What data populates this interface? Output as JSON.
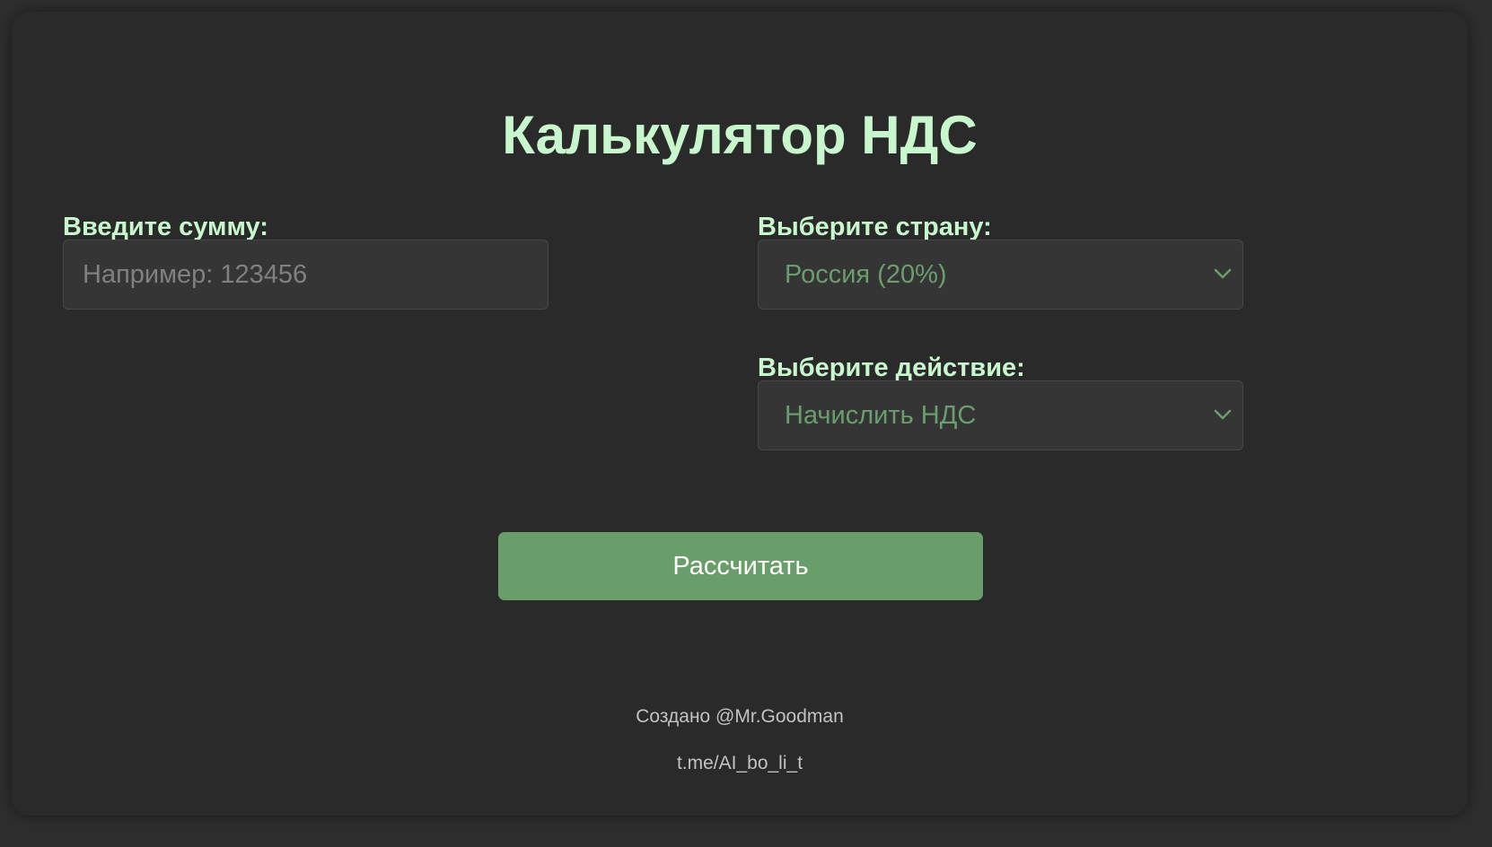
{
  "page": {
    "title": "Калькулятор НДС"
  },
  "amount": {
    "label": "Введите сумму:",
    "placeholder": "Например: 123456",
    "value": ""
  },
  "country": {
    "label": "Выберите страну:",
    "selected": "Россия (20%)"
  },
  "action": {
    "label": "Выберите действие:",
    "selected": "Начислить НДС"
  },
  "calculate_button": {
    "label": "Рассчитать"
  },
  "footer": {
    "credit": "Создано @Mr.Goodman",
    "link": "t.me/AI_bo_li_t"
  },
  "colors": {
    "background": "#2e2e2e",
    "card": "#2a2a2a",
    "heading": "#c8f7cd",
    "accent": "#699d69",
    "select_text": "#6a9e6e"
  }
}
